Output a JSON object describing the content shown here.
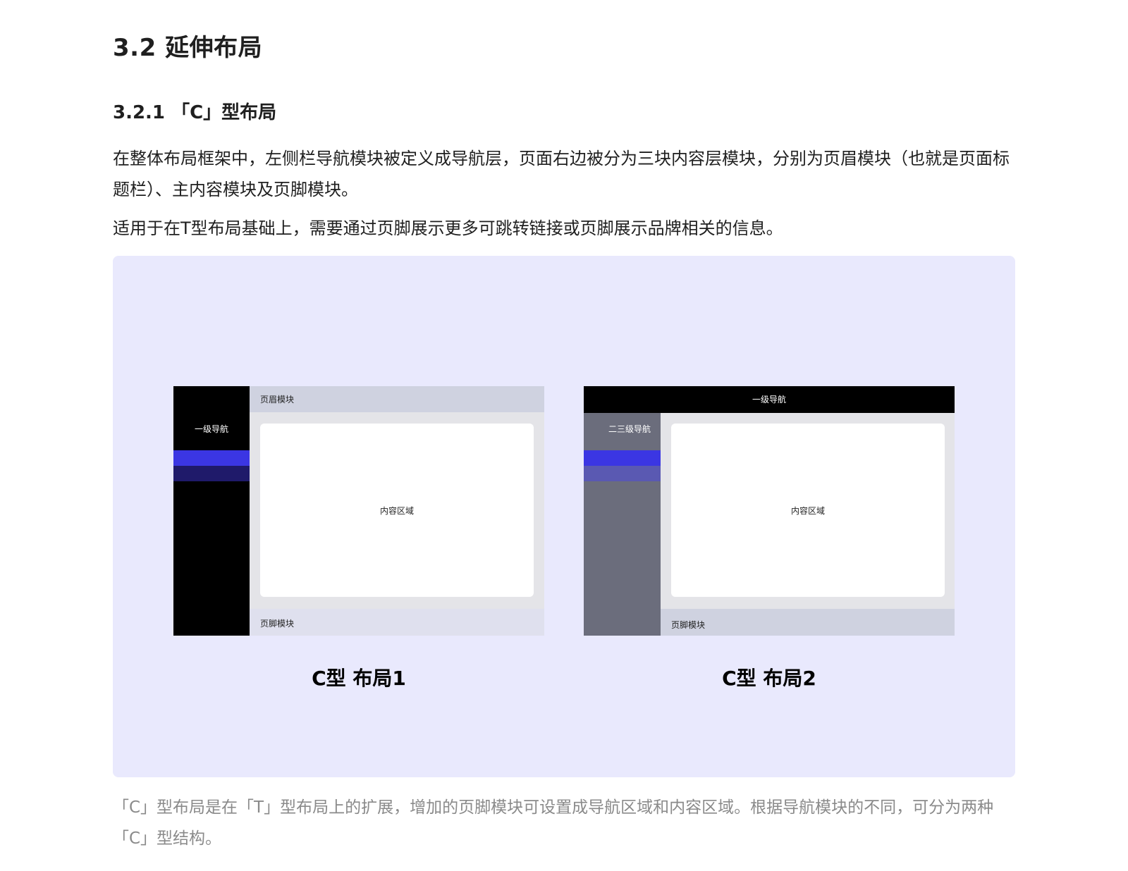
{
  "section_title": "3.2 延伸布局",
  "subsection_title": "3.2.1 「C」型布局",
  "paragraph_1": "在整体布局框架中，左侧栏导航模块被定义成导航层，页面右边被分为三块内容层模块，分别为页眉模块（也就是页面标题栏）、主内容模块及页脚模块。",
  "paragraph_2": "适用于在T型布局基础上，需要通过页脚展示更多可跳转链接或页脚展示品牌相关的信息。",
  "figure": {
    "background": "#e9e9fd",
    "layout1": {
      "nav_label": "一级导航",
      "header_label": "页眉模块",
      "content_label": "内容区域",
      "footer_label": "页脚模块",
      "caption": "C型 布局1"
    },
    "layout2": {
      "top_nav_label": "一级导航",
      "side_nav_label": "二三级导航",
      "content_label": "内容区域",
      "footer_label": "页脚模块",
      "caption": "C型 布局2"
    }
  },
  "caption_text": "「C」型布局是在「T」型布局上的扩展，增加的页脚模块可设置成导航区域和内容区域。根据导航模块的不同，可分为两种「C」型结构。"
}
